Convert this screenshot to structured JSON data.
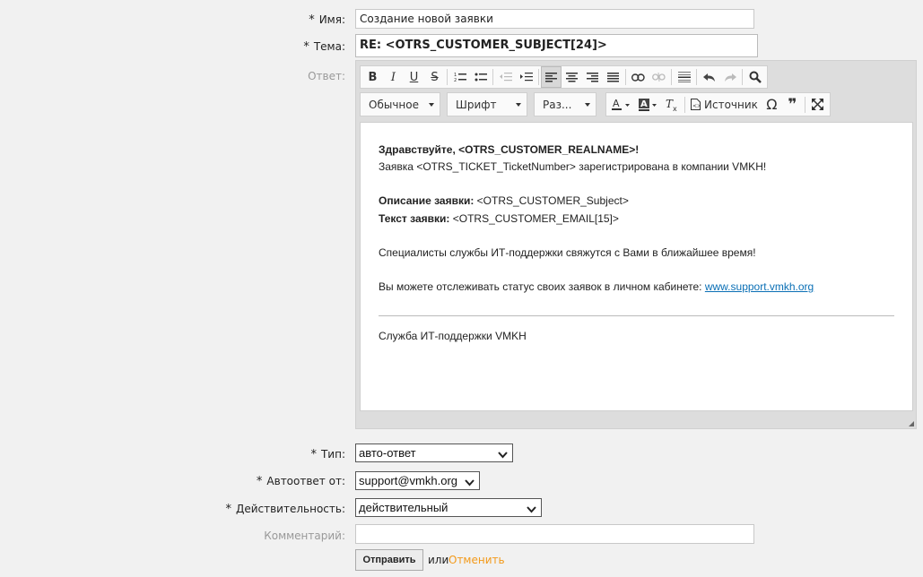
{
  "form": {
    "name_label": "Имя:",
    "name_value": "Создание новой заявки",
    "subject_label": "Тема:",
    "subject_value": "RE: <OTRS_CUSTOMER_SUBJECT[24]>",
    "answer_label": "Ответ:",
    "type_label": "Тип:",
    "type_value": "авто-ответ",
    "autoreply_label": "Автоответ от:",
    "autoreply_value": "support@vmkh.org",
    "validity_label": "Действительность:",
    "validity_value": "действительный",
    "comment_label": "Комментарий:",
    "comment_value": "",
    "submit_label": "Отправить",
    "or_text": "или",
    "cancel_label": "Отменить",
    "required_mark": "*"
  },
  "toolbar": {
    "format_combo": "Обычное",
    "font_combo": "Шрифт",
    "size_combo": "Раз...",
    "source_label": "Источник"
  },
  "editor": {
    "greeting": "Здравствуйте, <OTRS_CUSTOMER_REALNAME>!",
    "line2": "Заявка <OTRS_TICKET_TicketNumber> зарегистрирована в компании VMKH!",
    "desc_label": "Описание заявки:",
    "desc_value": " <OTRS_CUSTOMER_Subject>",
    "text_label": "Текст заявки:",
    "text_value": " <OTRS_CUSTOMER_EMAIL[15]>",
    "specialists": "Специалисты службы ИТ-поддержки свяжутся с Вами в ближайшее время!",
    "track_text": "Вы можете отслеживать статус своих заявок в личном кабинете: ",
    "track_link": "www.support.vmkh.org",
    "signature": "Служба ИТ-поддержки VMKH"
  },
  "colors": {
    "link": "#0a6fb5",
    "cancel": "#f39a1a",
    "page_bg": "#f1f1f1"
  }
}
